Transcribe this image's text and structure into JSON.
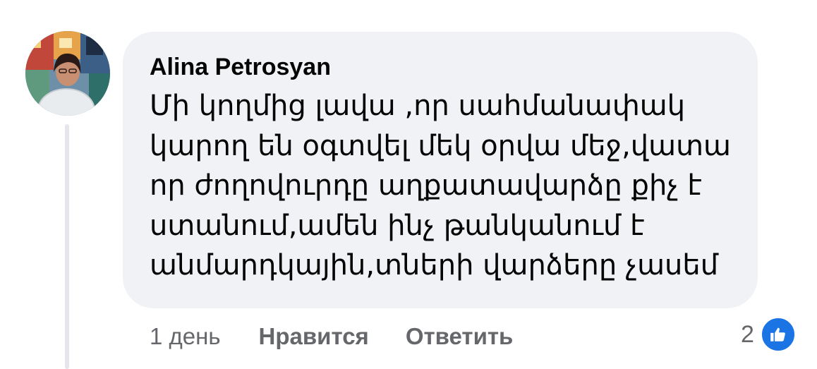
{
  "comment": {
    "author": "Alina Petrosyan",
    "lines": [
      "Մի կողմից լավա ,որ սահմանափակ",
      "կարող են օգտվել մեկ օրվա մեջ,վատա",
      "որ ժողովուրդը աղքատավարձը քիչ է",
      "ստանում,ամեն ինչ թանկանում է",
      "անմարդկային,տների վարձերը չասեմ"
    ],
    "timestamp": "1 день",
    "like_label": "Нравится",
    "reply_label": "Ответить",
    "reaction_count": "2",
    "reaction_icon": "thumbs-up-icon"
  },
  "colors": {
    "bubble": "#f0f2f5",
    "text": "#050505",
    "secondary": "#65676b",
    "like_blue": "#1b74e4",
    "thread_line": "#e4e6eb"
  }
}
